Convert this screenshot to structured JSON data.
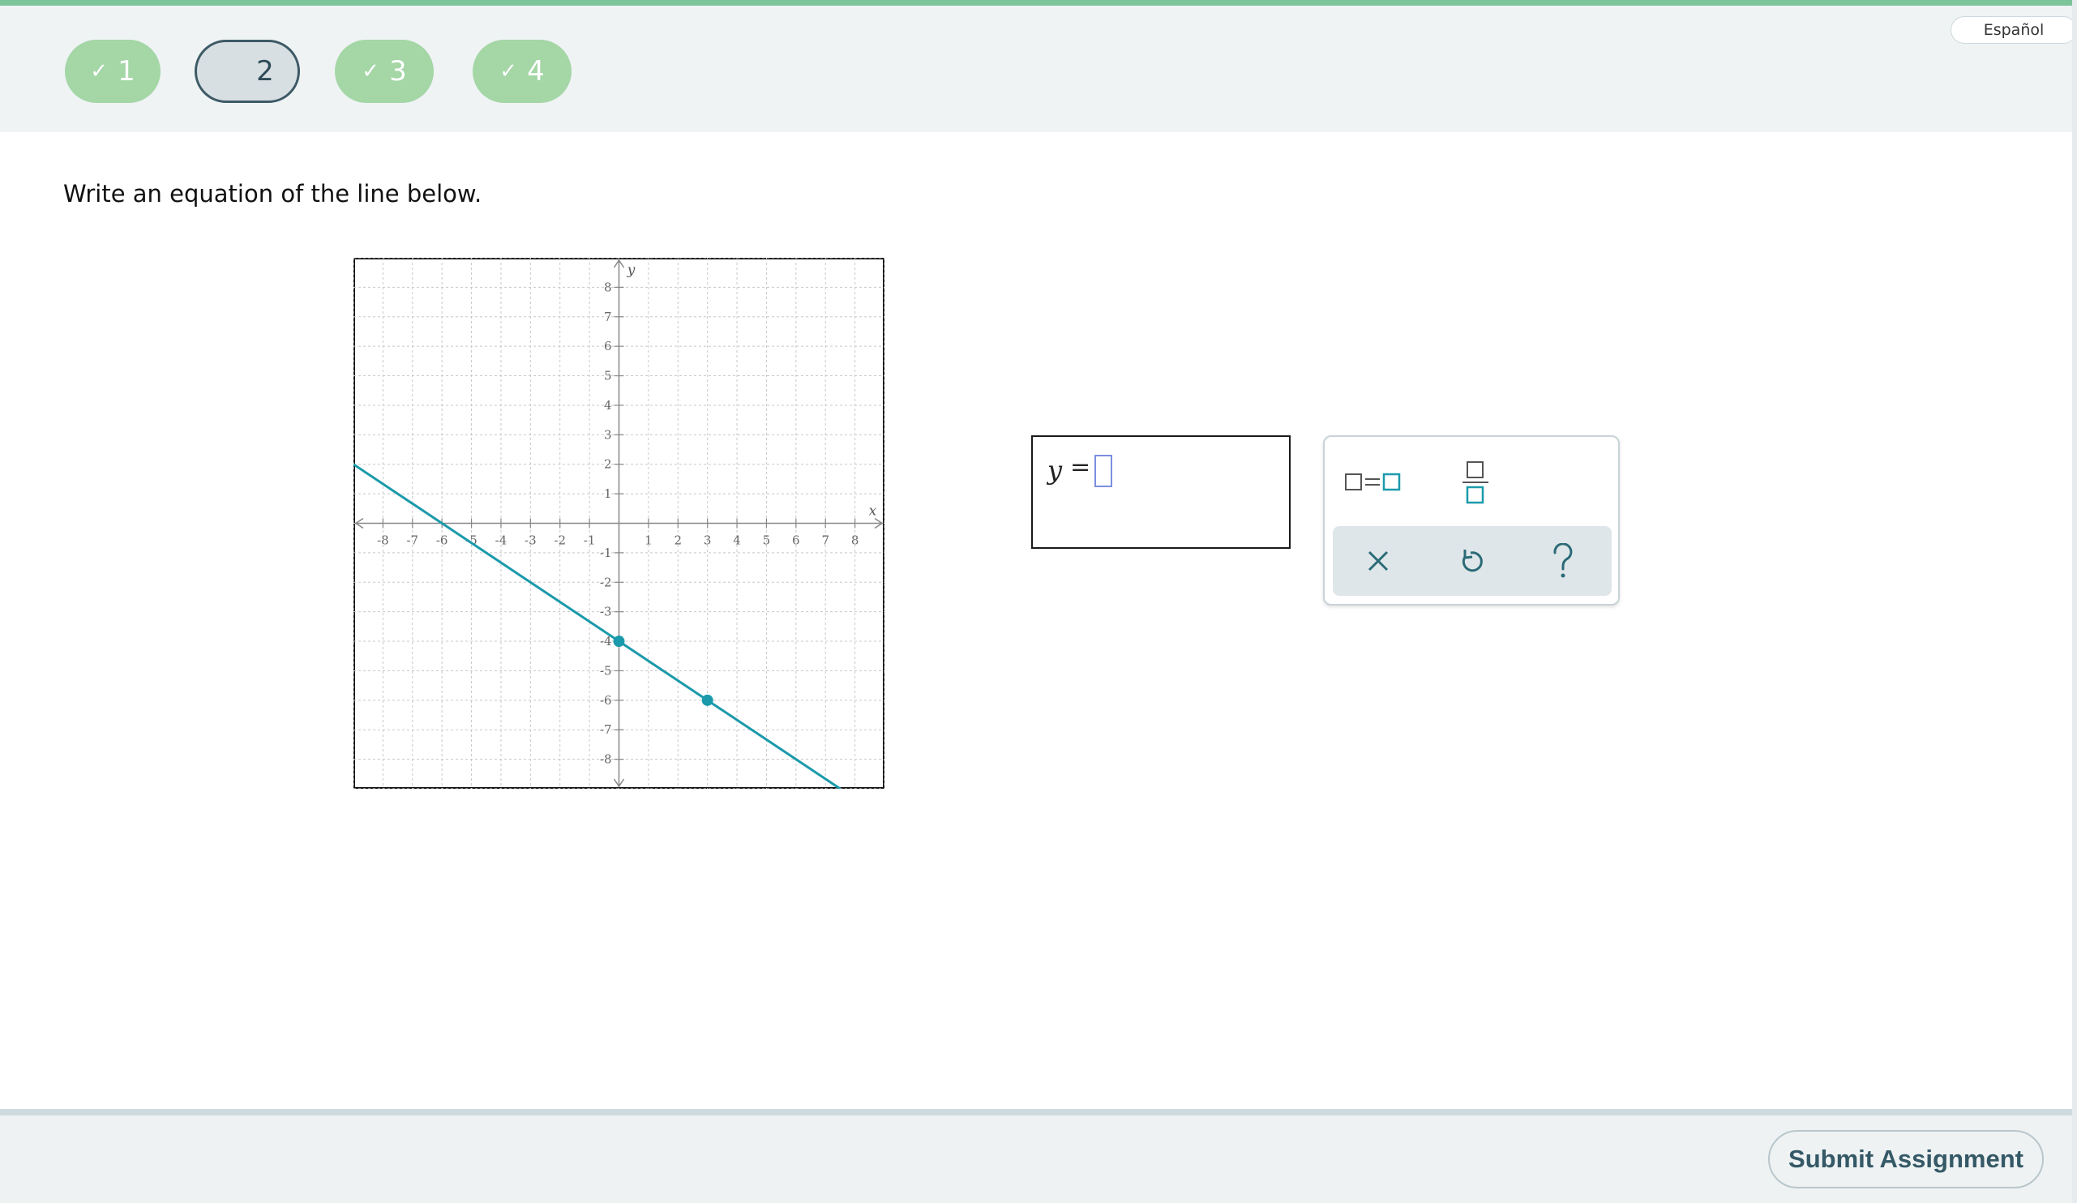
{
  "header": {
    "questions": [
      {
        "number": "1",
        "status": "completed"
      },
      {
        "number": "2",
        "status": "current"
      },
      {
        "number": "3",
        "status": "completed"
      },
      {
        "number": "4",
        "status": "completed"
      }
    ],
    "check_glyph": "✓",
    "language_label": "Español"
  },
  "question": {
    "prompt": "Write an equation of the line below."
  },
  "graph": {
    "x_label": "x",
    "y_label": "y",
    "x_ticks": [
      "-8",
      "-7",
      "-6",
      "-5",
      "-4",
      "-3",
      "-2",
      "-1",
      "1",
      "2",
      "3",
      "4",
      "5",
      "6",
      "7",
      "8"
    ],
    "y_ticks": [
      "8",
      "7",
      "6",
      "5",
      "4",
      "3",
      "2",
      "1",
      "-1",
      "-2",
      "-3",
      "-4",
      "-5",
      "-6",
      "-7",
      "-8"
    ],
    "xlim": [
      -9,
      9
    ],
    "ylim": [
      -9,
      9
    ],
    "points": [
      {
        "x": 0,
        "y": -4
      },
      {
        "x": 3,
        "y": -6
      }
    ],
    "line_color": "#1a9aab"
  },
  "answer": {
    "lhs": "y",
    "equals": "="
  },
  "keypad": {
    "keys": [
      "equation-template",
      "fraction-template",
      "clear",
      "undo",
      "help"
    ]
  },
  "footer": {
    "submit_label": "Submit Assignment"
  },
  "colors": {
    "accent_green": "#7ec49a",
    "completed_pill": "#a4d6a6",
    "teal": "#1a9aab"
  }
}
